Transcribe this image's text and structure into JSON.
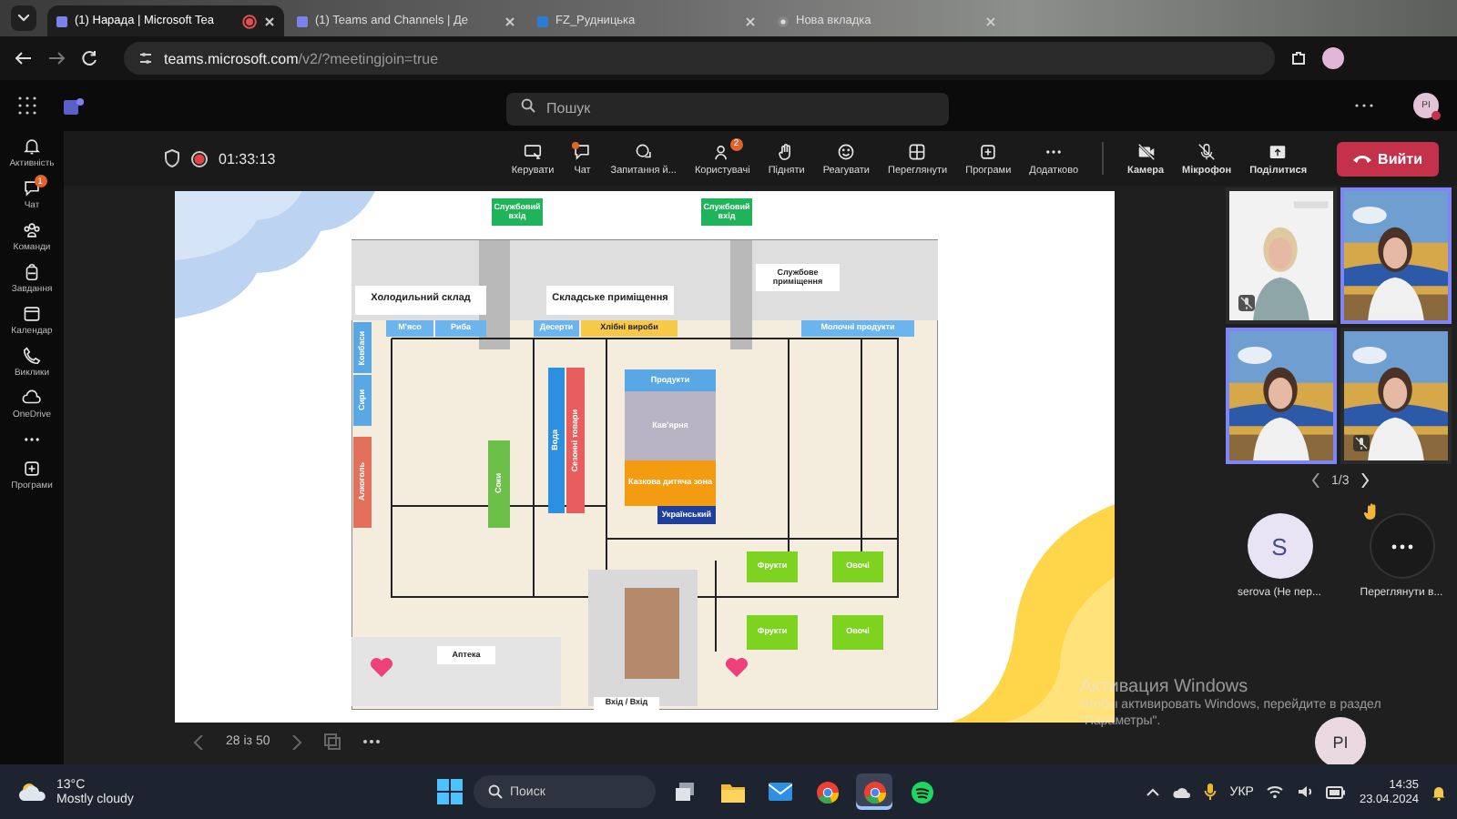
{
  "browser": {
    "tabs": [
      {
        "title": "(1) Нарада | Microsoft Tea",
        "kind": "teams",
        "selected": true,
        "recording": true
      },
      {
        "title": "(1) Teams and Channels | Де",
        "kind": "teams",
        "selected": false,
        "recording": false
      },
      {
        "title": "FZ_Рудницька",
        "kind": "word",
        "selected": false,
        "recording": false
      },
      {
        "title": "Нова вкладка",
        "kind": "chrome",
        "selected": false,
        "recording": false
      }
    ],
    "url_host": "teams.microsoft.com",
    "url_path": "/v2/?meetingjoin=true"
  },
  "teams_header": {
    "search_placeholder": "Пошук",
    "avatar_initials": "PI"
  },
  "app_bar": [
    {
      "label": "Активність",
      "kind": "bell"
    },
    {
      "label": "Чат",
      "kind": "chat",
      "badge": "1"
    },
    {
      "label": "Команди",
      "kind": "teams"
    },
    {
      "label": "Завдання",
      "kind": "backpack"
    },
    {
      "label": "Календар",
      "kind": "calendar"
    },
    {
      "label": "Виклики",
      "kind": "phone"
    },
    {
      "label": "OneDrive",
      "kind": "cloud"
    },
    {
      "kind": "more"
    },
    {
      "label": "Програми",
      "kind": "apps"
    }
  ],
  "meeting_bar": {
    "timer": "01:33:13",
    "recording": true,
    "actions": [
      {
        "label": "Керувати",
        "kind": "manage",
        "dot": false
      },
      {
        "label": "Чат",
        "kind": "chat",
        "dot": true
      },
      {
        "label": "Запитання й...",
        "kind": "qa",
        "dot": false
      },
      {
        "label": "Користувачі",
        "kind": "people",
        "dot": false,
        "badge": "2"
      },
      {
        "label": "Підняти",
        "kind": "hand",
        "dot": false
      },
      {
        "label": "Реагувати",
        "kind": "smile",
        "dot": false
      },
      {
        "label": "Переглянути",
        "kind": "grid",
        "dot": false
      },
      {
        "label": "Програми",
        "kind": "apps",
        "dot": false
      },
      {
        "label": "Додатково",
        "kind": "more",
        "dot": false
      }
    ],
    "camera": {
      "label": "Камера",
      "on": false
    },
    "microphone": {
      "label": "Мікрофон",
      "on": false
    },
    "share": {
      "label": "Поділитися"
    },
    "leave": {
      "label": "Вийти"
    }
  },
  "floor_plan": {
    "zones": [
      {
        "label": "Службовий вхід",
        "color": "#1fb35a",
        "kind": "band"
      },
      {
        "label": "Службовий вхід",
        "color": "#1fb35a",
        "kind": "band"
      },
      {
        "label": "Холодильний склад",
        "color": "#ffffff",
        "kind": "band"
      },
      {
        "label": "Складське приміщення",
        "color": "#ffffff",
        "kind": "band"
      },
      {
        "label": "Службове приміщення",
        "color": "#ffffff",
        "kind": "band"
      },
      {
        "label": "М'ясо",
        "color": "#6cb4ee",
        "kind": "band"
      },
      {
        "label": "Риба",
        "color": "#6cb4ee",
        "kind": "band"
      },
      {
        "label": "Десерти",
        "color": "#6cb4ee",
        "kind": "band"
      },
      {
        "label": "Хлібні вироби",
        "color": "#f7c948",
        "kind": "band"
      },
      {
        "label": "Молочні продукти",
        "color": "#6cb4ee",
        "kind": "band"
      },
      {
        "label": "Ковбаси",
        "color": "#5aa7e6",
        "kind": "column"
      },
      {
        "label": "Сири",
        "color": "#5aa7e6",
        "kind": "column"
      },
      {
        "label": "Алкоголь",
        "color": "#e2705a",
        "kind": "column"
      },
      {
        "label": "Вода",
        "color": "#2d8fe0",
        "kind": "column"
      },
      {
        "label": "Сезонні товари",
        "color": "#e85d5d",
        "kind": "column"
      },
      {
        "label": "Соки",
        "color": "#6cc04a",
        "kind": "column"
      },
      {
        "label": "Продукти",
        "color": "#5aa7e6",
        "kind": "band"
      },
      {
        "label": "Кав'ярня",
        "color": "#b9b4c3",
        "kind": "band"
      },
      {
        "label": "Казкова дитяча зона",
        "color": "#f39c12",
        "kind": "band"
      },
      {
        "label": "Український",
        "color": "#1f3f9e",
        "kind": "band"
      },
      {
        "label": "Фрукти",
        "color": "#7ed321",
        "kind": "band"
      },
      {
        "label": "Овочі",
        "color": "#7ed321",
        "kind": "band"
      },
      {
        "label": "Фрукти",
        "color": "#7ed321",
        "kind": "band"
      },
      {
        "label": "Овочі",
        "color": "#7ed321",
        "kind": "band"
      },
      {
        "label": "Аптека",
        "color": "#ffffff",
        "kind": "band"
      },
      {
        "label": "Вхід / Вхід",
        "color": "#ffffff",
        "kind": "band"
      }
    ]
  },
  "slide_nav": {
    "page": "28 із 50"
  },
  "videos": [
    {
      "kind": "picture",
      "speaking": false,
      "muted": true
    },
    {
      "kind": "picture",
      "speaking": true,
      "muted": false
    },
    {
      "kind": "picture",
      "speaking": true,
      "muted": false
    },
    {
      "kind": "picture",
      "speaking": false,
      "muted": true
    }
  ],
  "video_pager": "1/3",
  "participants": [
    {
      "kind": "avatar",
      "initial": "S",
      "name": "serova (Не пер...",
      "hand_raised": false
    },
    {
      "kind": "more",
      "name": "Переглянути в...",
      "hand_raised": true
    }
  ],
  "self_view": {
    "initials": "PI"
  },
  "activation": {
    "title": "Активация Windows",
    "text": "Чтобы активировать Windows, перейдите в раздел \"Параметры\"."
  },
  "taskbar": {
    "weather": {
      "temp": "13°C",
      "condition": "Mostly cloudy"
    },
    "search_placeholder": "Поиск",
    "apps": [
      {
        "kind": "files",
        "selected": false
      },
      {
        "kind": "folder",
        "selected": false
      },
      {
        "kind": "mail",
        "selected": false
      },
      {
        "kind": "chrome",
        "selected": false
      },
      {
        "kind": "chrome",
        "selected": true
      },
      {
        "kind": "spotify",
        "selected": false
      }
    ],
    "language": "УКР",
    "time": "14:35",
    "date": "23.04.2024"
  }
}
